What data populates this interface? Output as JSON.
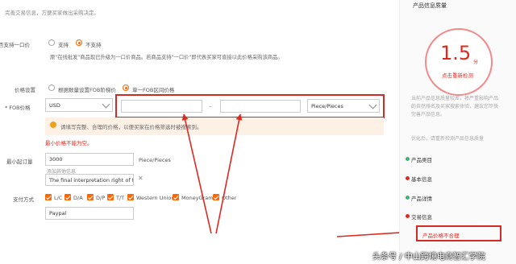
{
  "form": {
    "intro_text": "完善交易信息，方便买家做出采购决定。",
    "one_price": {
      "label": "否支持一口价",
      "options": [
        "支持",
        "不支持"
      ],
      "selected": "不支持",
      "note": "原\"在线批发\"商品现已升级为一口价商品。若商品支持\"一口价\"即代表买家可直接以此价格采购该商品。"
    },
    "price_setting": {
      "label": "价格设置",
      "options": [
        "根据数量设置FOB阶梯价",
        "单一FOB区间价格"
      ],
      "selected": "单一FOB区间价格"
    },
    "fob": {
      "label": "* FOB价格",
      "currency": "USD",
      "min_value": "",
      "separator": "–",
      "max_value": "",
      "unit": "Piece/Pieces",
      "warning": "请填写完整、合理的价格，以便买家在价格筛选时被搜索到。",
      "error": "最小价格不能为空。"
    },
    "moq": {
      "label": "最小起订量",
      "value": "3000",
      "unit": "Piece/Pieces",
      "add_other": "添加其他信息",
      "extra_value": "The final interpretation right of this"
    },
    "payment": {
      "label": "支付方式",
      "methods": [
        "L/C",
        "D/A",
        "D/P",
        "T/T",
        "Western Union",
        "MoneyGram",
        "Other"
      ],
      "other_value": "Paypal"
    }
  },
  "sidebar": {
    "title": "产品信息质量",
    "score": "1.5",
    "score_unit": "分",
    "recheck_link": "点击重新检测",
    "desc": "当前产品信息质量较差，将严重影响产品的自然排名及买家搜索体验，建议您尽快完善产品信息。",
    "optimize_tip": "优化后，请重新检测产品信息质量",
    "items": [
      {
        "label": "产品类目",
        "status": "ok"
      },
      {
        "label": "基本信息",
        "status": "bad"
      },
      {
        "label": "产品详情",
        "status": "ok"
      },
      {
        "label": "交易信息",
        "status": "bad"
      },
      {
        "label": "产品价格不合理",
        "status": "issue"
      }
    ]
  },
  "watermark": "头条号 / 中山跨境电商智汇学院",
  "colors": {
    "accent": "#ff6600",
    "highlight": "#e0281e",
    "ok": "#3cb371"
  }
}
